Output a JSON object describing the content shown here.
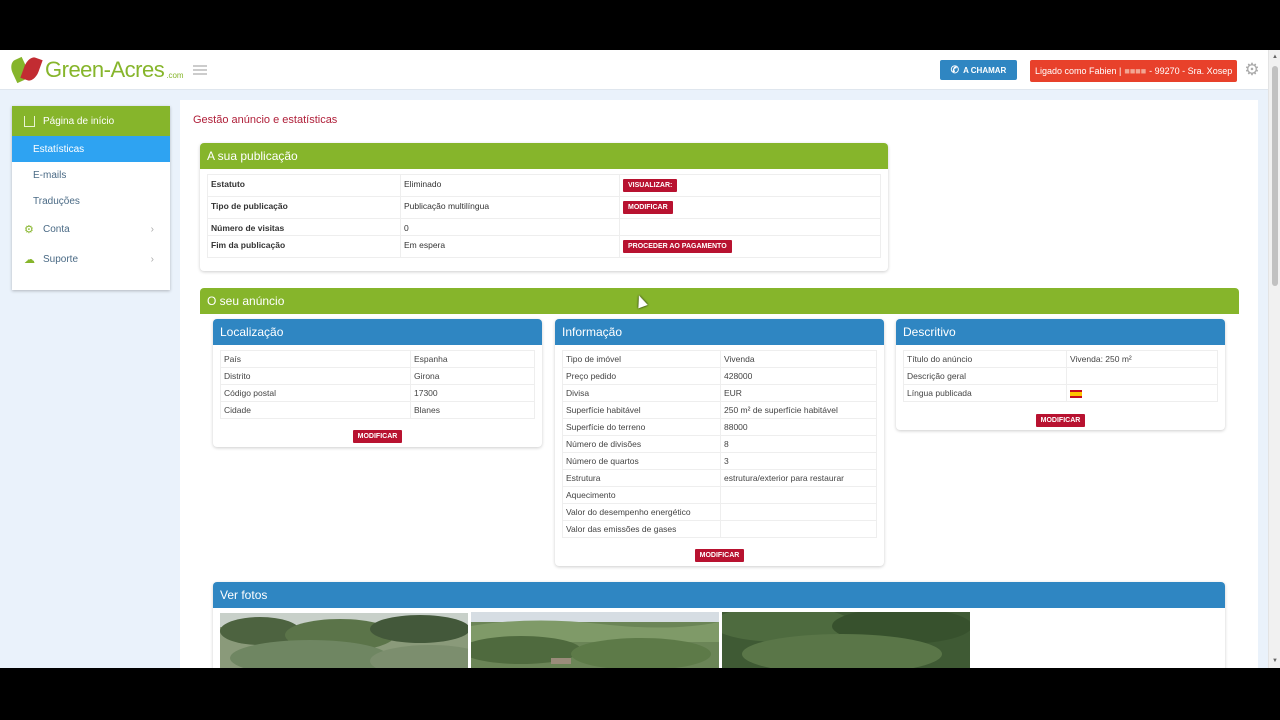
{
  "brand": {
    "name": "Green-Acres",
    "tld": ".com"
  },
  "topbar": {
    "call_label": "A CHAMAR",
    "user_prefix": "Ligado como Fabien |",
    "user_masked": "■■■■",
    "user_suffix": "- 99270 - Sra. Xosep"
  },
  "sidebar": {
    "home": "Página de início",
    "subitems": [
      "Estatísticas",
      "E-mails",
      "Traduções"
    ],
    "items": [
      {
        "label": "Conta",
        "icon": "gear-icon"
      },
      {
        "label": "Suporte",
        "icon": "chat-icon"
      }
    ]
  },
  "page_title": "Gestão anúncio e estatísticas",
  "publication": {
    "title": "A sua publicação",
    "rows": [
      {
        "label": "Estatuto",
        "value": "Eliminado",
        "action": "VISUALIZAR:"
      },
      {
        "label": "Tipo de publicação",
        "value": "Publicação multilíngua",
        "action": "MODIFICAR"
      },
      {
        "label": "Número de visitas",
        "value": "0",
        "action": ""
      },
      {
        "label": "Fim da publicação",
        "value": "Em espera",
        "action": "PROCEDER AO PAGAMENTO"
      }
    ]
  },
  "ad": {
    "title": "O seu anúncio",
    "location": {
      "title": "Localização",
      "rows": [
        [
          "País",
          "Espanha"
        ],
        [
          "Distrito",
          "Girona"
        ],
        [
          "Código postal",
          "17300"
        ],
        [
          "Cidade",
          "Blanes"
        ]
      ],
      "button": "MODIFICAR"
    },
    "info": {
      "title": "Informação",
      "rows": [
        [
          "Tipo de imóvel",
          "Vivenda"
        ],
        [
          "Preço pedido",
          "428000"
        ],
        [
          "Divisa",
          "EUR"
        ],
        [
          "Superfície habitável",
          "250 m² de superfície habitável"
        ],
        [
          "Superfície do terreno",
          "88000"
        ],
        [
          "Número de divisões",
          "8"
        ],
        [
          "Número de quartos",
          "3"
        ],
        [
          "Estrutura",
          "estrutura/exterior para restaurar"
        ],
        [
          "Aquecimento",
          ""
        ],
        [
          "Valor do desempenho energético",
          ""
        ],
        [
          "Valor das emissões de gases",
          ""
        ]
      ],
      "button": "MODIFICAR"
    },
    "description": {
      "title": "Descritivo",
      "rows": [
        [
          "Título do anúncio",
          "Vivenda: 250 m²"
        ],
        [
          "Descrição geral",
          ""
        ],
        [
          "Língua publicada",
          ""
        ]
      ],
      "flag": "spain-flag-icon",
      "button": "MODIFICAR"
    },
    "photos": {
      "title": "Ver fotos"
    }
  },
  "colors": {
    "green": "#86b52b",
    "blue": "#2f86c2",
    "red": "#b81230",
    "user_badge": "#e8412b"
  }
}
